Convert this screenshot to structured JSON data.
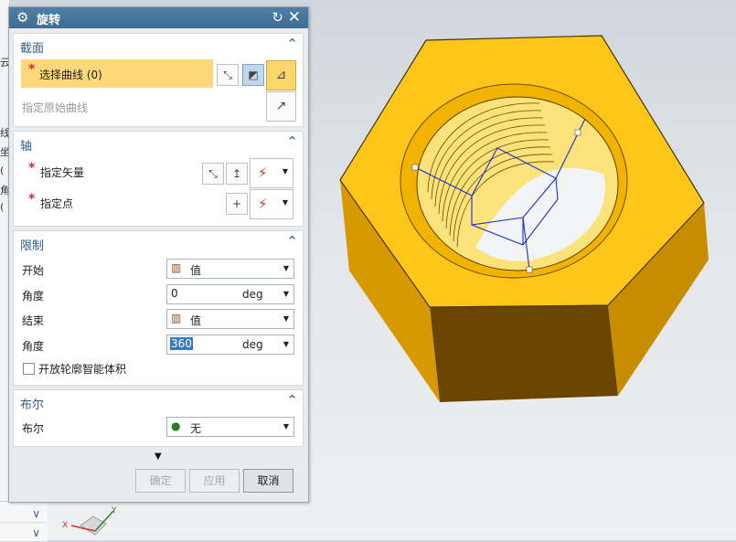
{
  "dialog": {
    "title": "旋转",
    "icons": {
      "settings": "gear-icon",
      "reset": "reset-icon",
      "close": "close-icon"
    }
  },
  "section": {
    "title": "截面",
    "select_curve": "选择曲线 (0)",
    "specify_original_curve": "指定原始曲线"
  },
  "axis": {
    "title": "轴",
    "specify_vector": "指定矢量",
    "specify_point": "指定点"
  },
  "limits": {
    "title": "限制",
    "start_label": "开始",
    "start_option": "值",
    "start_angle_label": "角度",
    "start_angle_value": "0",
    "start_angle_unit": "deg",
    "end_label": "结束",
    "end_option": "值",
    "end_angle_label": "角度",
    "end_angle_value": "360",
    "end_angle_unit": "deg",
    "open_profile_label": "开放轮廓智能体积",
    "open_profile_checked": false
  },
  "boolean": {
    "title": "布尔",
    "label": "布尔",
    "value": "无"
  },
  "footer": {
    "ok": "确定",
    "apply": "应用",
    "cancel": "取消"
  },
  "left_panel_fragments": [
    "云",
    "线",
    "坐",
    "(",
    "角",
    "("
  ],
  "triad": {
    "x_label": "X",
    "y_label": "Y"
  },
  "colors": {
    "title_bar": "#3f6d93",
    "section_title": "#2f5d8c",
    "selection_highlight": "#fcd87a",
    "nut_top": "#ffc61a",
    "nut_side_light": "#e3a800",
    "nut_side_dark": "#6b4400",
    "curve": "#1b2fd0"
  }
}
